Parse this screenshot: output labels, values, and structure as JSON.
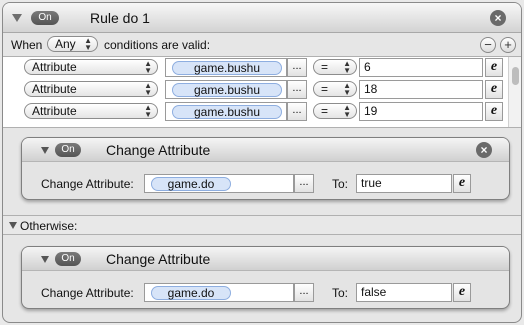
{
  "rule": {
    "on_label": "On",
    "title": "Rule do 1",
    "when_label": "When",
    "match_value": "Any",
    "conditions_label": "conditions are valid:",
    "add_label": "+",
    "remove_label": "−",
    "close_label": "×"
  },
  "conditions": [
    {
      "type": "Attribute",
      "attribute": "game.bushu",
      "ellipsis": "...",
      "operator": "=",
      "value": "6",
      "expr": "e"
    },
    {
      "type": "Attribute",
      "attribute": "game.bushu",
      "ellipsis": "...",
      "operator": "=",
      "value": "18",
      "expr": "e"
    },
    {
      "type": "Attribute",
      "attribute": "game.bushu",
      "ellipsis": "...",
      "operator": "=",
      "value": "19",
      "expr": "e"
    }
  ],
  "then_action": {
    "on_label": "On",
    "title": "Change Attribute",
    "field_label": "Change Attribute:",
    "attribute": "game.do",
    "ellipsis": "...",
    "to_label": "To:",
    "to_value": "true",
    "expr": "e",
    "close_label": "×"
  },
  "otherwise": {
    "label": "Otherwise:"
  },
  "else_action": {
    "on_label": "On",
    "title": "Change Attribute",
    "field_label": "Change Attribute:",
    "attribute": "game.do",
    "ellipsis": "...",
    "to_label": "To:",
    "to_value": "false",
    "expr": "e"
  }
}
